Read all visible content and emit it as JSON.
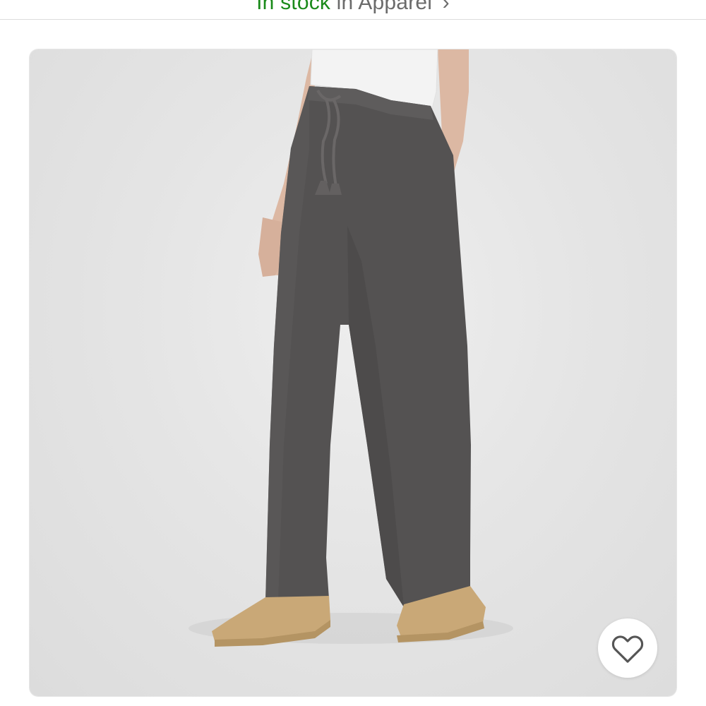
{
  "header": {
    "stock_status": "In stock",
    "stock_category": "in Apparel",
    "chevron_icon": "chevron-right-icon"
  },
  "product": {
    "image_icon": "product-photo-lounge-pants",
    "favorite_icon": "heart-outline-icon"
  },
  "colors": {
    "stock_green": "#1a8a1a",
    "muted_text": "#6b6b6b",
    "pants_gray": "#545252",
    "background_gray": "#e5e5e5",
    "slipper_tan": "#c9a877"
  }
}
